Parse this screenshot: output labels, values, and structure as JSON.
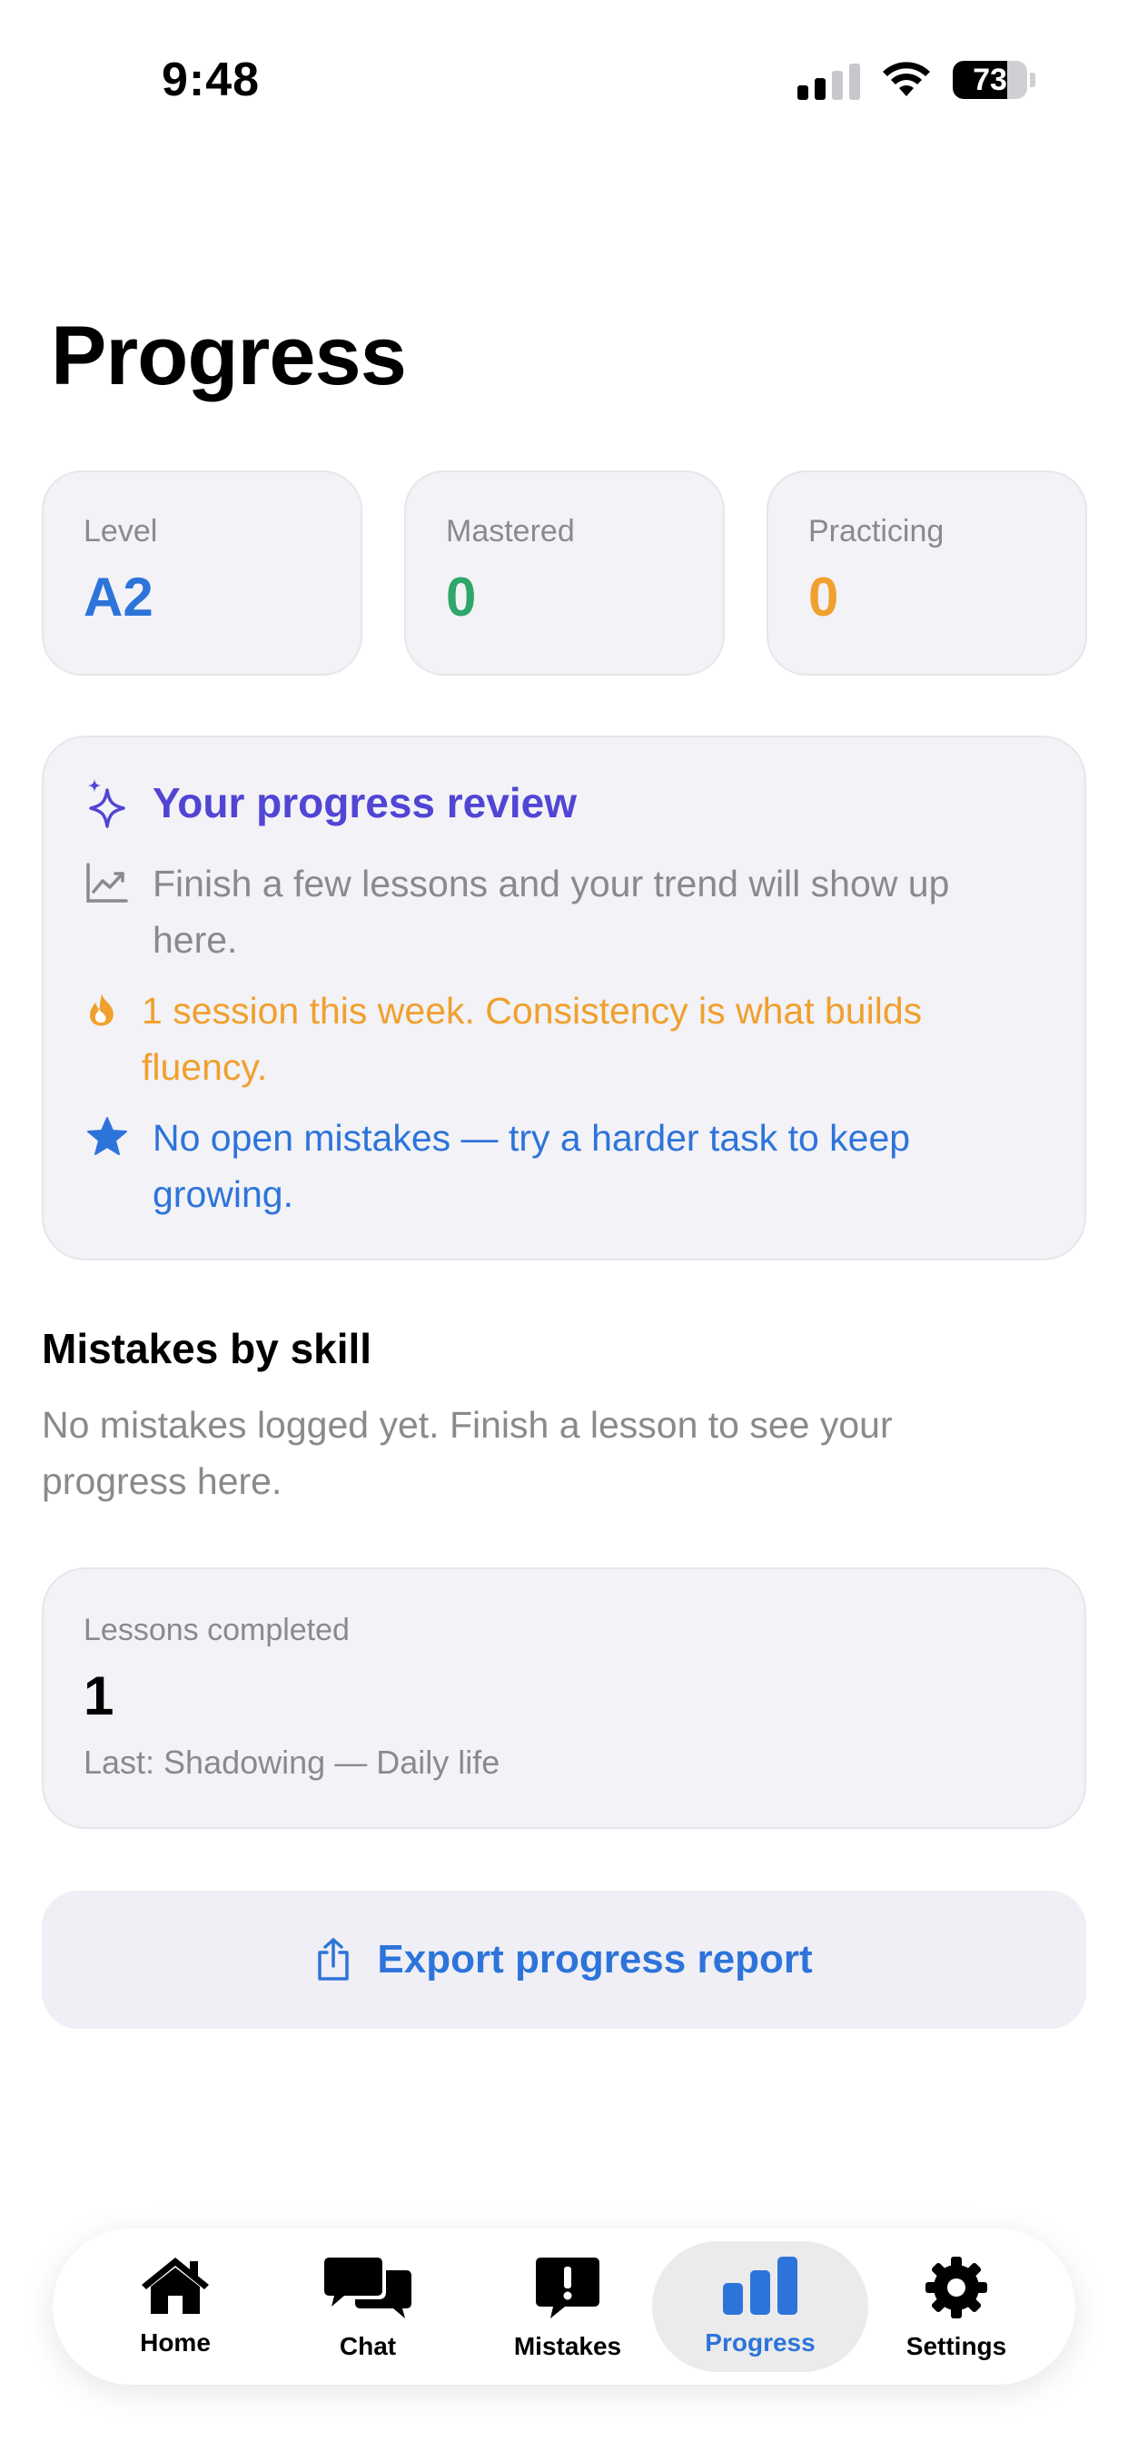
{
  "status_bar": {
    "time": "9:48",
    "battery": "73",
    "battery_level": 0.73
  },
  "page_title": "Progress",
  "stats": [
    {
      "label": "Level",
      "value": "A2",
      "color": "#2d74da"
    },
    {
      "label": "Mastered",
      "value": "0",
      "color": "#2fa66a"
    },
    {
      "label": "Practicing",
      "value": "0",
      "color": "#f0a02e"
    }
  ],
  "review": {
    "title": "Your progress review",
    "items": [
      {
        "icon": "trend-chart-icon",
        "text": "Finish a few lessons and your trend will show up here.",
        "color": "#8a8a8e"
      },
      {
        "icon": "flame-icon",
        "text": "1 session this week. Consistency is what builds fluency.",
        "color": "#f0a02e"
      },
      {
        "icon": "star-icon",
        "text": "No open mistakes — try a harder task to keep growing.",
        "color": "#2d74da"
      }
    ]
  },
  "mistakes_section": {
    "title": "Mistakes by skill",
    "body": "No mistakes logged yet. Finish a lesson to see your progress here."
  },
  "lessons": {
    "label": "Lessons completed",
    "value": "1",
    "last": "Last: Shadowing — Daily life"
  },
  "export_button": {
    "label": "Export progress report",
    "icon": "share-icon"
  },
  "tabs": [
    {
      "label": "Home",
      "icon": "house-icon",
      "active": false
    },
    {
      "label": "Chat",
      "icon": "chat-bubbles-icon",
      "active": false
    },
    {
      "label": "Mistakes",
      "icon": "exclamation-bubble-icon",
      "active": false
    },
    {
      "label": "Progress",
      "icon": "bar-chart-icon",
      "active": true
    },
    {
      "label": "Settings",
      "icon": "gear-icon",
      "active": false
    }
  ],
  "colors": {
    "accent": "#2d74da",
    "purple": "#5145d4",
    "card": "#f2f2f7",
    "muted": "#8a8a8e"
  }
}
